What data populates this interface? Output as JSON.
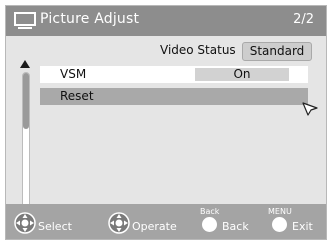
{
  "title_bar": {
    "icon": "tv-icon",
    "title": "Picture Adjust",
    "page": "2/2"
  },
  "video_status": {
    "label": "Video Status",
    "value": "Standard"
  },
  "menu": {
    "items": [
      {
        "label": "VSM",
        "value": "On",
        "selected": false
      },
      {
        "label": "Reset",
        "value": "",
        "selected": true
      }
    ]
  },
  "scrollbar": {
    "up_icon": "arrow-up-icon",
    "down_icon": "arrow-down-icon"
  },
  "footer": {
    "select": {
      "icon": "joystick-icon",
      "label": "Select"
    },
    "operate": {
      "icon": "joystick-icon",
      "label": "Operate"
    },
    "back": {
      "key": "Back",
      "icon": "circle-button-icon",
      "label": "Back"
    },
    "exit": {
      "key": "MENU",
      "icon": "circle-button-icon",
      "label": "Exit"
    }
  },
  "colors": {
    "title_bar": "#8d8d8d",
    "panel": "#e5e5e5",
    "selected_row": "#a9a9a9",
    "footer": "#a4a4a4"
  }
}
